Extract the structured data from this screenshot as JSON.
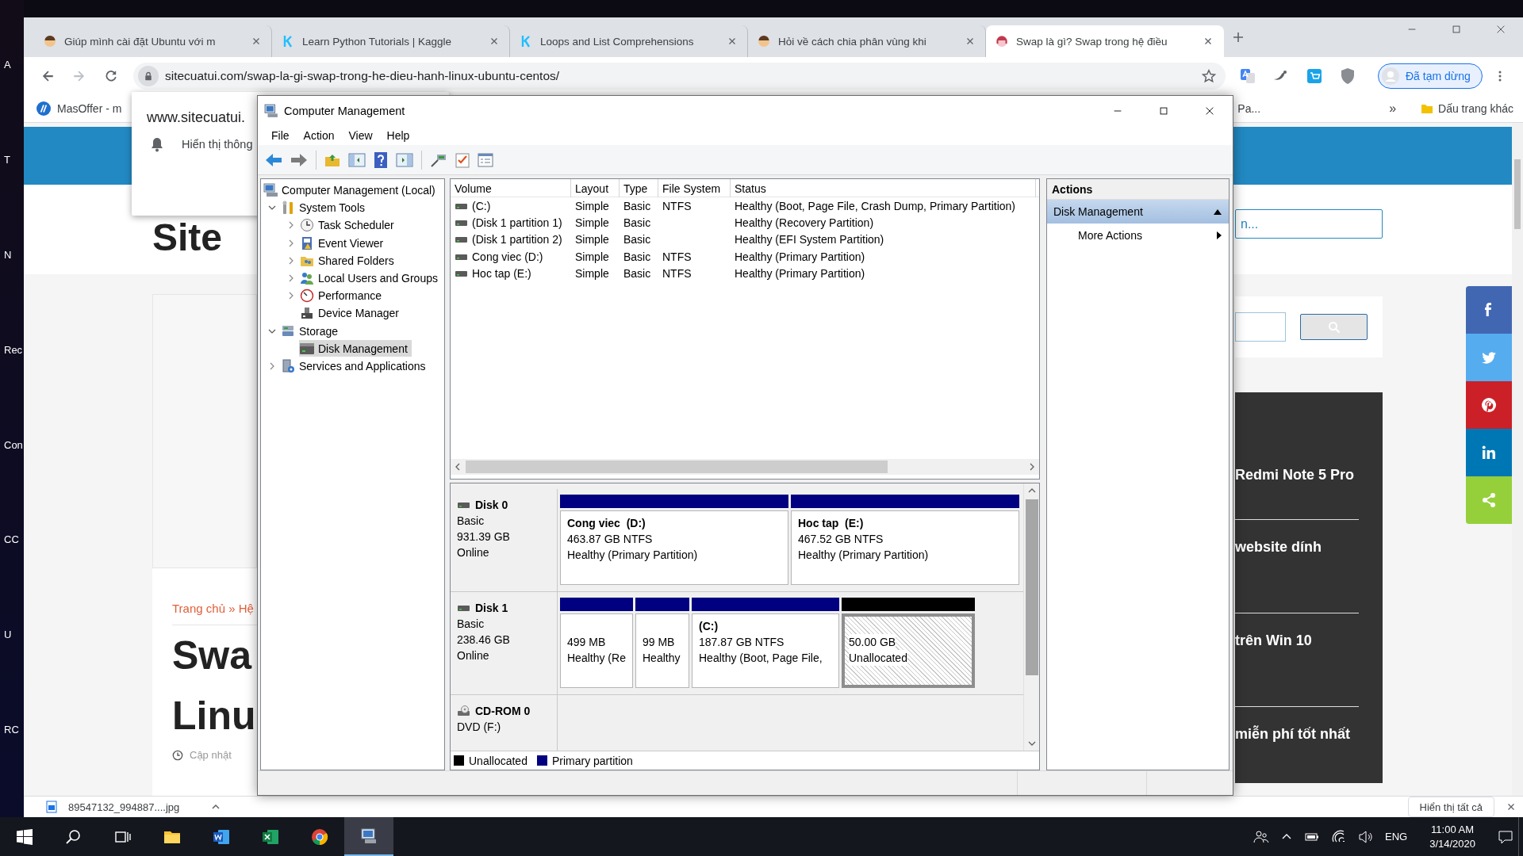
{
  "desktop": {
    "icon_labels": [
      "A",
      "T",
      "N",
      "Rec",
      "Con",
      "CC",
      "U",
      "RC"
    ]
  },
  "browser": {
    "tabs": [
      {
        "kind": "face",
        "title": "Giúp mình cài đặt Ubuntu với m",
        "selected": false
      },
      {
        "kind": "k-logo",
        "title": "Learn Python Tutorials | Kaggle",
        "selected": false
      },
      {
        "kind": "k-logo",
        "title": "Loops and List Comprehensions",
        "selected": false
      },
      {
        "kind": "face",
        "title": "Hỏi về cách chia phân vùng khi",
        "selected": false
      },
      {
        "kind": "avatar",
        "title": "Swap là gì? Swap trong hệ điều",
        "selected": true
      }
    ],
    "url": "sitecuatui.com/swap-la-gi-swap-trong-he-dieu-hanh-linux-ubuntu-centos/",
    "profile": "Đã tạm dừng",
    "bookmarks": [
      "MasOffer - m",
      "Pa..."
    ],
    "more_bookmarks": "»",
    "other_bookmarks": "Dấu trang khác"
  },
  "notification": {
    "site": "www.sitecuatui.",
    "text": "Hiển thị thông"
  },
  "page": {
    "site_title": "Site",
    "search_placeholder": "n...",
    "breadcrumb": "Trang chủ » Hệ",
    "article_title": [
      "Swa",
      "Linu"
    ],
    "updated": "Cập nhật",
    "posts": [
      "Redmi Note 5 Pro",
      "website dính",
      "trên Win 10",
      "miễn phí tốt nhất"
    ],
    "share": [
      {
        "kind": "facebook",
        "color": "#4267b2"
      },
      {
        "kind": "twitter",
        "color": "#55acee"
      },
      {
        "kind": "pinterest",
        "color": "#cb2027"
      },
      {
        "kind": "linkedin",
        "color": "#0077b5"
      },
      {
        "kind": "share",
        "color": "#95d03a"
      }
    ]
  },
  "downloads": {
    "file": "89547132_994887....jpg",
    "show_all": "Hiển thị tất cả"
  },
  "window": {
    "title": "Computer Management",
    "menu": [
      "File",
      "Action",
      "View",
      "Help"
    ],
    "tree": [
      {
        "label": "Computer Management (Local)",
        "kind": "computer",
        "selected": false,
        "children": [
          {
            "label": "System Tools",
            "kind": "tools",
            "expanded": true,
            "selected": false,
            "children": [
              {
                "label": "Task Scheduler",
                "kind": "clock",
                "expanded": false,
                "selected": false
              },
              {
                "label": "Event Viewer",
                "kind": "log",
                "expanded": false,
                "selected": false
              },
              {
                "label": "Shared Folders",
                "kind": "folder",
                "expanded": false,
                "selected": false
              },
              {
                "label": "Local Users and Groups",
                "kind": "users",
                "expanded": false,
                "selected": false
              },
              {
                "label": "Performance",
                "kind": "gauge",
                "expanded": false,
                "selected": false
              },
              {
                "label": "Device Manager",
                "kind": "device",
                "selected": false
              }
            ]
          },
          {
            "label": "Storage",
            "kind": "storage",
            "expanded": true,
            "selected": false,
            "children": [
              {
                "label": "Disk Management",
                "kind": "drive",
                "selected": true
              }
            ]
          },
          {
            "label": "Services and Applications",
            "kind": "server",
            "expanded": false,
            "selected": false
          }
        ]
      }
    ],
    "volumes": {
      "columns": [
        "Volume",
        "Layout",
        "Type",
        "File System",
        "Status"
      ],
      "rows": [
        {
          "volume": "(C:)",
          "layout": "Simple",
          "type": "Basic",
          "file_system": "NTFS",
          "status": "Healthy (Boot, Page File, Crash Dump, Primary Partition)"
        },
        {
          "volume": "(Disk 1 partition 1)",
          "layout": "Simple",
          "type": "Basic",
          "status": "Healthy (Recovery Partition)"
        },
        {
          "volume": "(Disk 1 partition 2)",
          "layout": "Simple",
          "type": "Basic",
          "status": "Healthy (EFI System Partition)"
        },
        {
          "volume": "Cong viec (D:)",
          "layout": "Simple",
          "type": "Basic",
          "file_system": "NTFS",
          "status": "Healthy (Primary Partition)"
        },
        {
          "volume": "Hoc tap (E:)",
          "layout": "Simple",
          "type": "Basic",
          "file_system": "NTFS",
          "status": "Healthy (Primary Partition)"
        }
      ]
    },
    "disks": [
      {
        "kind": "disk",
        "name": "Disk 0",
        "details": [
          "Basic",
          "931.39 GB",
          "Online"
        ],
        "partitions": [
          {
            "kind": "primary",
            "name": "Cong viec  (D:)",
            "size": "463.87 GB NTFS",
            "status": "Healthy (Primary Partition)"
          },
          {
            "kind": "primary",
            "name": "Hoc tap  (E:)",
            "size": "467.52 GB NTFS",
            "status": "Healthy (Primary Partition)"
          }
        ]
      },
      {
        "kind": "disk",
        "name": "Disk 1",
        "details": [
          "Basic",
          "238.46 GB",
          "Online"
        ],
        "partitions": [
          {
            "kind": "primary",
            "size": "499 MB",
            "status": "Healthy (Re"
          },
          {
            "kind": "primary",
            "size": "99 MB",
            "status": "Healthy"
          },
          {
            "kind": "primary",
            "name": "(C:)",
            "size": "187.87 GB NTFS",
            "status": "Healthy (Boot, Page File,"
          },
          {
            "kind": "unallocated",
            "size": "50.00 GB",
            "status": "Unallocated"
          }
        ]
      },
      {
        "kind": "cdrom",
        "name": "CD-ROM 0",
        "details": [
          "DVD (F:)"
        ]
      }
    ],
    "legend": [
      {
        "label": "Unallocated",
        "color": "#000000"
      },
      {
        "label": "Primary partition",
        "color": "#000080"
      }
    ],
    "actions": {
      "title": "Actions",
      "sections": [
        {
          "label": "Disk Management",
          "expanded": true,
          "items": [
            "More Actions"
          ]
        }
      ]
    }
  },
  "taskbar": {
    "apps": [
      {
        "kind": "folder",
        "active": false
      },
      {
        "kind": "document",
        "active": false
      },
      {
        "kind": "spreadsheet",
        "active": false
      },
      {
        "kind": "browser",
        "active": false
      },
      {
        "kind": "console",
        "active": true
      }
    ],
    "language": "ENG",
    "time": "11:00 AM",
    "date": "3/14/2020"
  }
}
